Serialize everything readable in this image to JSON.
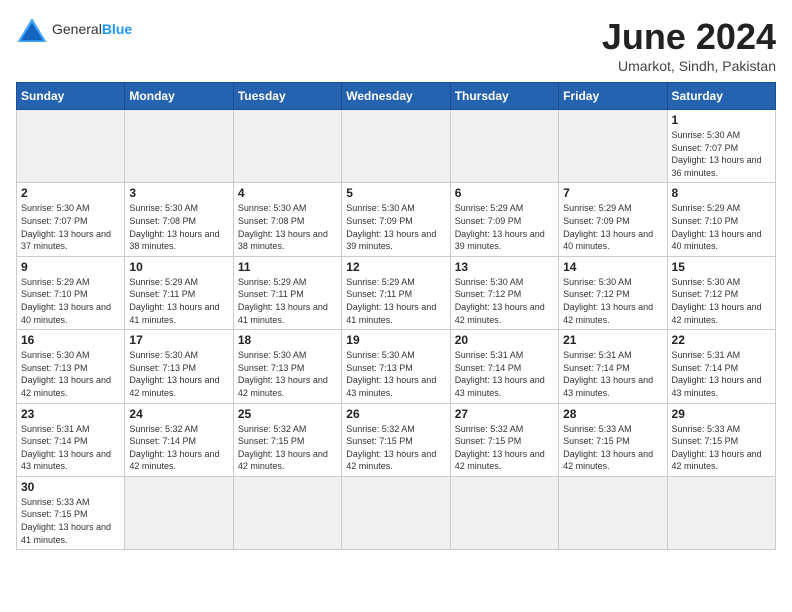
{
  "header": {
    "logo_general": "General",
    "logo_blue": "Blue",
    "title": "June 2024",
    "subtitle": "Umarkot, Sindh, Pakistan"
  },
  "calendar": {
    "days_of_week": [
      "Sunday",
      "Monday",
      "Tuesday",
      "Wednesday",
      "Thursday",
      "Friday",
      "Saturday"
    ],
    "weeks": [
      [
        {
          "day": null,
          "info": null
        },
        {
          "day": null,
          "info": null
        },
        {
          "day": null,
          "info": null
        },
        {
          "day": null,
          "info": null
        },
        {
          "day": null,
          "info": null
        },
        {
          "day": null,
          "info": null
        },
        {
          "day": "1",
          "info": "Sunrise: 5:30 AM\nSunset: 7:07 PM\nDaylight: 13 hours and 36 minutes."
        }
      ],
      [
        {
          "day": "2",
          "info": "Sunrise: 5:30 AM\nSunset: 7:07 PM\nDaylight: 13 hours and 37 minutes."
        },
        {
          "day": "3",
          "info": "Sunrise: 5:30 AM\nSunset: 7:08 PM\nDaylight: 13 hours and 38 minutes."
        },
        {
          "day": "4",
          "info": "Sunrise: 5:30 AM\nSunset: 7:08 PM\nDaylight: 13 hours and 38 minutes."
        },
        {
          "day": "5",
          "info": "Sunrise: 5:30 AM\nSunset: 7:09 PM\nDaylight: 13 hours and 39 minutes."
        },
        {
          "day": "6",
          "info": "Sunrise: 5:29 AM\nSunset: 7:09 PM\nDaylight: 13 hours and 39 minutes."
        },
        {
          "day": "7",
          "info": "Sunrise: 5:29 AM\nSunset: 7:09 PM\nDaylight: 13 hours and 40 minutes."
        },
        {
          "day": "8",
          "info": "Sunrise: 5:29 AM\nSunset: 7:10 PM\nDaylight: 13 hours and 40 minutes."
        }
      ],
      [
        {
          "day": "9",
          "info": "Sunrise: 5:29 AM\nSunset: 7:10 PM\nDaylight: 13 hours and 40 minutes."
        },
        {
          "day": "10",
          "info": "Sunrise: 5:29 AM\nSunset: 7:11 PM\nDaylight: 13 hours and 41 minutes."
        },
        {
          "day": "11",
          "info": "Sunrise: 5:29 AM\nSunset: 7:11 PM\nDaylight: 13 hours and 41 minutes."
        },
        {
          "day": "12",
          "info": "Sunrise: 5:29 AM\nSunset: 7:11 PM\nDaylight: 13 hours and 41 minutes."
        },
        {
          "day": "13",
          "info": "Sunrise: 5:30 AM\nSunset: 7:12 PM\nDaylight: 13 hours and 42 minutes."
        },
        {
          "day": "14",
          "info": "Sunrise: 5:30 AM\nSunset: 7:12 PM\nDaylight: 13 hours and 42 minutes."
        },
        {
          "day": "15",
          "info": "Sunrise: 5:30 AM\nSunset: 7:12 PM\nDaylight: 13 hours and 42 minutes."
        }
      ],
      [
        {
          "day": "16",
          "info": "Sunrise: 5:30 AM\nSunset: 7:13 PM\nDaylight: 13 hours and 42 minutes."
        },
        {
          "day": "17",
          "info": "Sunrise: 5:30 AM\nSunset: 7:13 PM\nDaylight: 13 hours and 42 minutes."
        },
        {
          "day": "18",
          "info": "Sunrise: 5:30 AM\nSunset: 7:13 PM\nDaylight: 13 hours and 42 minutes."
        },
        {
          "day": "19",
          "info": "Sunrise: 5:30 AM\nSunset: 7:13 PM\nDaylight: 13 hours and 43 minutes."
        },
        {
          "day": "20",
          "info": "Sunrise: 5:31 AM\nSunset: 7:14 PM\nDaylight: 13 hours and 43 minutes."
        },
        {
          "day": "21",
          "info": "Sunrise: 5:31 AM\nSunset: 7:14 PM\nDaylight: 13 hours and 43 minutes."
        },
        {
          "day": "22",
          "info": "Sunrise: 5:31 AM\nSunset: 7:14 PM\nDaylight: 13 hours and 43 minutes."
        }
      ],
      [
        {
          "day": "23",
          "info": "Sunrise: 5:31 AM\nSunset: 7:14 PM\nDaylight: 13 hours and 43 minutes."
        },
        {
          "day": "24",
          "info": "Sunrise: 5:32 AM\nSunset: 7:14 PM\nDaylight: 13 hours and 42 minutes."
        },
        {
          "day": "25",
          "info": "Sunrise: 5:32 AM\nSunset: 7:15 PM\nDaylight: 13 hours and 42 minutes."
        },
        {
          "day": "26",
          "info": "Sunrise: 5:32 AM\nSunset: 7:15 PM\nDaylight: 13 hours and 42 minutes."
        },
        {
          "day": "27",
          "info": "Sunrise: 5:32 AM\nSunset: 7:15 PM\nDaylight: 13 hours and 42 minutes."
        },
        {
          "day": "28",
          "info": "Sunrise: 5:33 AM\nSunset: 7:15 PM\nDaylight: 13 hours and 42 minutes."
        },
        {
          "day": "29",
          "info": "Sunrise: 5:33 AM\nSunset: 7:15 PM\nDaylight: 13 hours and 42 minutes."
        }
      ],
      [
        {
          "day": "30",
          "info": "Sunrise: 5:33 AM\nSunset: 7:15 PM\nDaylight: 13 hours and 41 minutes."
        },
        {
          "day": null,
          "info": null
        },
        {
          "day": null,
          "info": null
        },
        {
          "day": null,
          "info": null
        },
        {
          "day": null,
          "info": null
        },
        {
          "day": null,
          "info": null
        },
        {
          "day": null,
          "info": null
        }
      ]
    ]
  }
}
